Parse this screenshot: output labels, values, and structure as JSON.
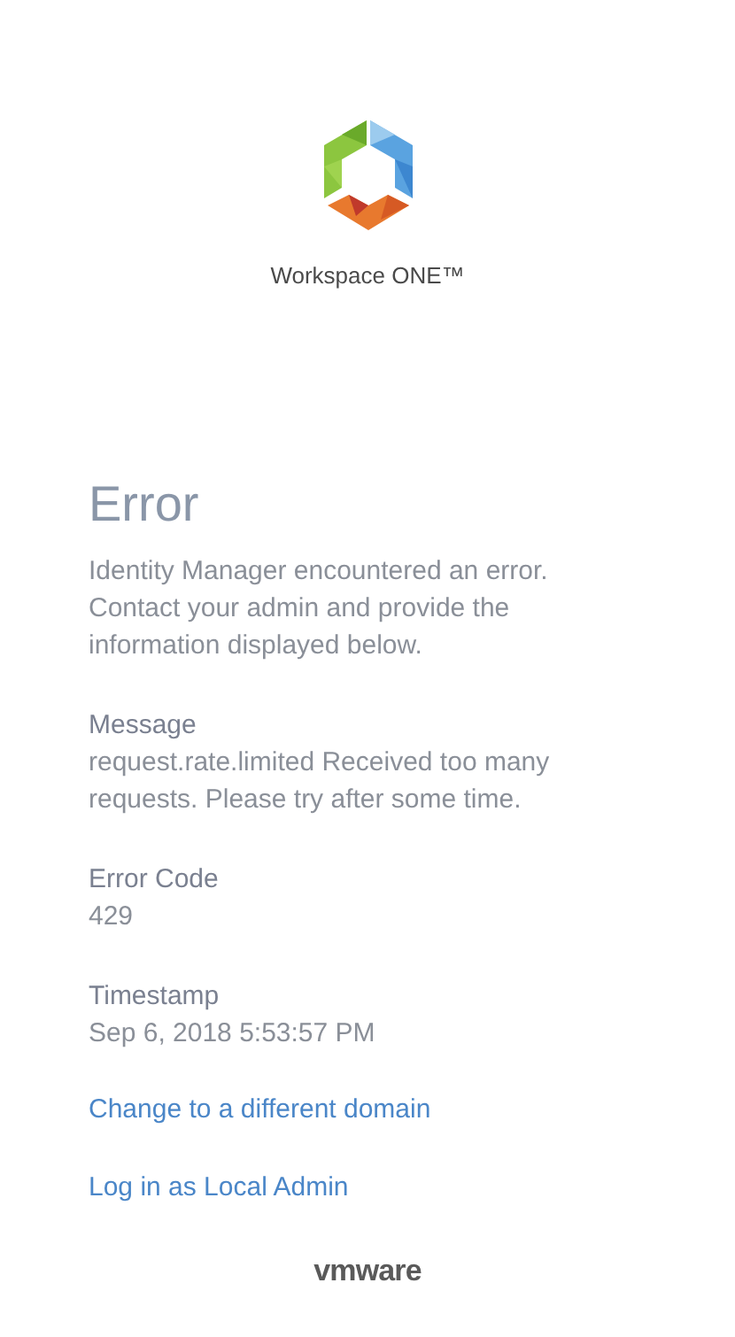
{
  "brand": {
    "product": "Workspace ONE™"
  },
  "error": {
    "title": "Error",
    "description": "Identity Manager encountered an error. Contact your admin and provide the information displayed below.",
    "details": [
      {
        "label": "Message",
        "value": "request.rate.limited Received too many requests. Please try after some time."
      },
      {
        "label": "Error Code",
        "value": "429"
      },
      {
        "label": "Timestamp",
        "value": "Sep 6, 2018 5:53:57 PM"
      }
    ]
  },
  "links": [
    "Change to a different domain",
    "Log in as Local Admin"
  ],
  "footer": {
    "logo": "vmware"
  }
}
